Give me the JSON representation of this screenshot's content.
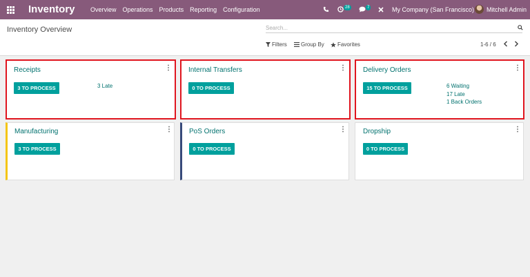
{
  "navbar": {
    "app_name": "Inventory",
    "menu": [
      "Overview",
      "Operations",
      "Products",
      "Reporting",
      "Configuration"
    ],
    "activity_count": "28",
    "message_count": "7",
    "company": "My Company (San Francisco)",
    "user": "Mitchell Admin"
  },
  "control_panel": {
    "breadcrumb": "Inventory Overview",
    "search_placeholder": "Search...",
    "filters_label": "Filters",
    "group_by_label": "Group By",
    "favorites_label": "Favorites",
    "pager": "1-6 / 6"
  },
  "cards": [
    {
      "title": "Receipts",
      "button": "3 TO PROCESS",
      "links": [
        "3 Late"
      ],
      "highlighted": true
    },
    {
      "title": "Internal Transfers",
      "button": "0 TO PROCESS",
      "links": [],
      "highlighted": true
    },
    {
      "title": "Delivery Orders",
      "button": "15 TO PROCESS",
      "links": [
        "6 Waiting",
        "17 Late",
        "1 Back Orders"
      ],
      "highlighted": true
    },
    {
      "title": "Manufacturing",
      "button": "3 TO PROCESS",
      "links": [],
      "stripe_color": "#f4c512"
    },
    {
      "title": "PoS Orders",
      "button": "0 TO PROCESS",
      "links": [],
      "stripe_color": "#374a7a"
    },
    {
      "title": "Dropship",
      "button": "0 TO PROCESS",
      "links": []
    }
  ],
  "colors": {
    "navbar": "#875a7b",
    "accent": "#00a09d",
    "title_link": "#00716e",
    "highlight_border": "#e0141e"
  }
}
